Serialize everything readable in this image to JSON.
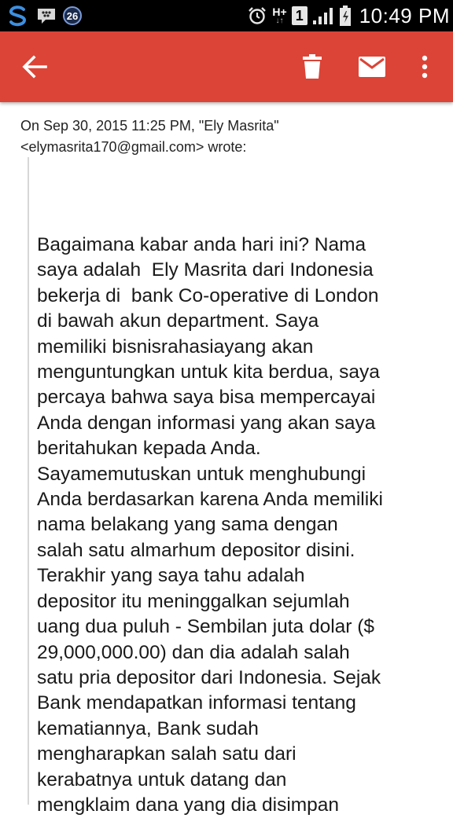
{
  "status_bar": {
    "notification_count": "26",
    "sim_slot": "1",
    "network_type": "H+",
    "time": "10:49 PM",
    "icons": [
      "swiftkey-icon",
      "bbm-icon",
      "notification-count-icon",
      "alarm-icon",
      "network-hplus-icon",
      "sim-icon",
      "signal-icon",
      "battery-icon"
    ]
  },
  "app_bar": {
    "color": "#db4437",
    "icons": [
      "back-arrow-icon",
      "delete-icon",
      "mail-icon",
      "overflow-menu-icon"
    ]
  },
  "email": {
    "header_line1": "On Sep 30, 2015 11:25 PM, \"Ely Masrita\"",
    "header_line2": "<elymasrita170@gmail.com> wrote:",
    "body_text": "Bagaimana kabar anda hari ini? Nama\nsaya adalah  Ely Masrita dari Indonesia\nbekerja di  bank Co-operative di London\ndi bawah akun department. Saya\nmemiliki bisnisrahasiayang akan\nmenguntungkan untuk kita berdua, saya\npercaya bahwa saya bisa mempercayai\nAnda dengan informasi yang akan saya\nberitahukan kepada Anda.\nSayamemutuskan untuk menghubungi\nAnda berdasarkan karena Anda memiliki\nnama belakang yang sama dengan\nsalah satu almarhum depositor disini.\nTerakhir yang saya tahu adalah\ndepositor itu meninggalkan sejumlah\nuang dua puluh - Sembilan juta dolar ($\n29,000,000.00) dan dia adalah salah\nsatu pria depositor dari Indonesia. Sejak\nBank mendapatkan informasi tentang\nkematiannya, Bank sudah\nmengharapkan salah satu dari\nkerabatnya untuk datang dan\nmengklaim dana yang dia disimpan"
  }
}
